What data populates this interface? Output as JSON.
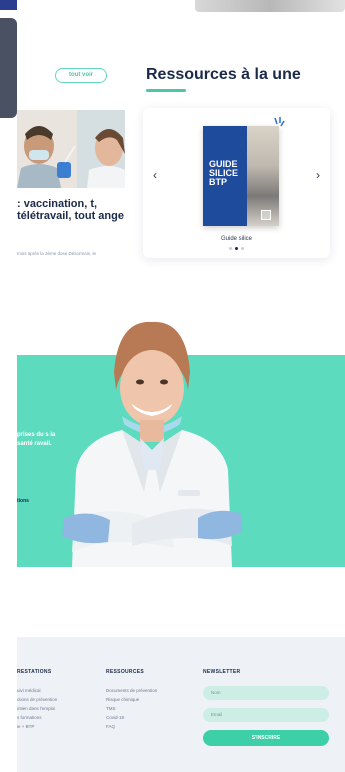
{
  "news": {
    "see_all_label": "tout voir",
    "title": ": vaccination, t, télétravail, tout ange",
    "excerpt": "mois après la 3ème dose Désormais, le"
  },
  "resources": {
    "title": "Ressources à la une",
    "book_title": "GUIDE SILICE BTP",
    "caption": "Guide silice",
    "prev_icon": "‹",
    "next_icon": "›",
    "slide_count": 3,
    "active_slide": 2
  },
  "promo": {
    "text": "prises du s la santé ravail.",
    "link_label": "tions"
  },
  "footer": {
    "prestations": {
      "heading": "RESTATIONS",
      "links": [
        "uivi médical",
        "ctions de prévention",
        "intien dans l'emploi",
        "s formations",
        "ie + BTP"
      ]
    },
    "ressources": {
      "heading": "RESSOURCES",
      "links": [
        "Documents de prévention",
        "Risque chimique",
        "TMS",
        "Covid-19",
        "FAQ"
      ]
    },
    "newsletter": {
      "heading": "NEWSLETTER",
      "name_placeholder": "Nom",
      "email_placeholder": "Email",
      "subscribe_label": "S'INSCRIRE"
    }
  },
  "colors": {
    "navy": "#1b2a4a",
    "mint": "#5cdbbf",
    "accent": "#49c7a6",
    "book_blue": "#1f4b9c"
  }
}
